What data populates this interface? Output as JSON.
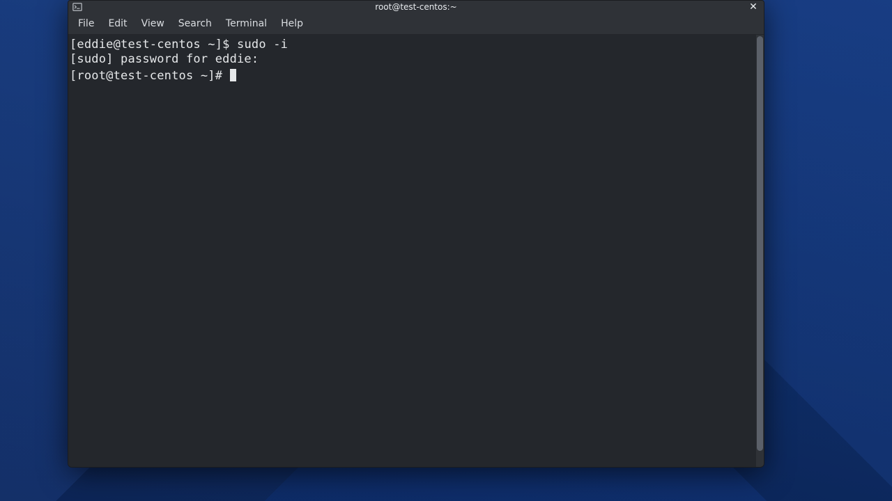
{
  "window": {
    "title": "root@test-centos:~"
  },
  "menubar": {
    "items": [
      {
        "label": "File"
      },
      {
        "label": "Edit"
      },
      {
        "label": "View"
      },
      {
        "label": "Search"
      },
      {
        "label": "Terminal"
      },
      {
        "label": "Help"
      }
    ]
  },
  "terminal": {
    "lines": [
      {
        "prompt": "[eddie@test-centos ~]$ ",
        "text": "sudo -i",
        "cursor": false
      },
      {
        "prompt": "",
        "text": "[sudo] password for eddie:",
        "cursor": false
      },
      {
        "prompt": "[root@test-centos ~]# ",
        "text": "",
        "cursor": true
      }
    ]
  }
}
